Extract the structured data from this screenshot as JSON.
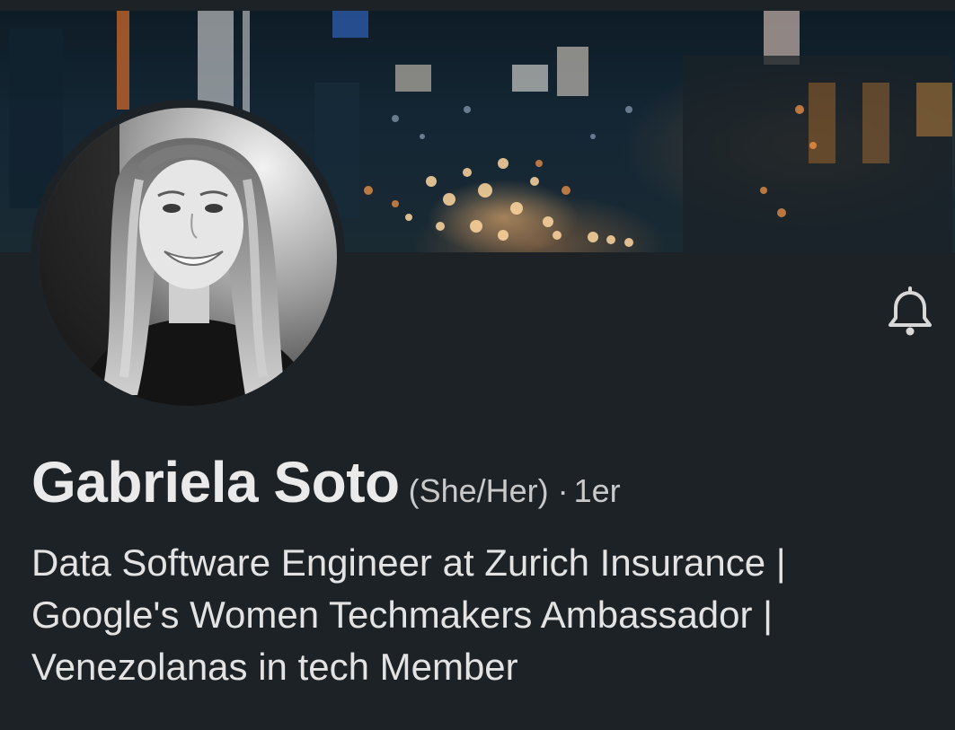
{
  "profile": {
    "name": "Gabriela Soto",
    "pronouns": "(She/Her)",
    "separator": "·",
    "connection_degree": "1er",
    "headline_lines": [
      "Data Software Engineer at Zurich Insurance |",
      "Google's Women Techmakers Ambassador |",
      "Venezolanas in tech Member"
    ]
  },
  "icons": {
    "notification": "bell-icon"
  },
  "colors": {
    "background": "#1d2226",
    "name_text": "#eaeaea",
    "secondary_text": "#c9c9c9",
    "icon": "#d8d8d8"
  }
}
